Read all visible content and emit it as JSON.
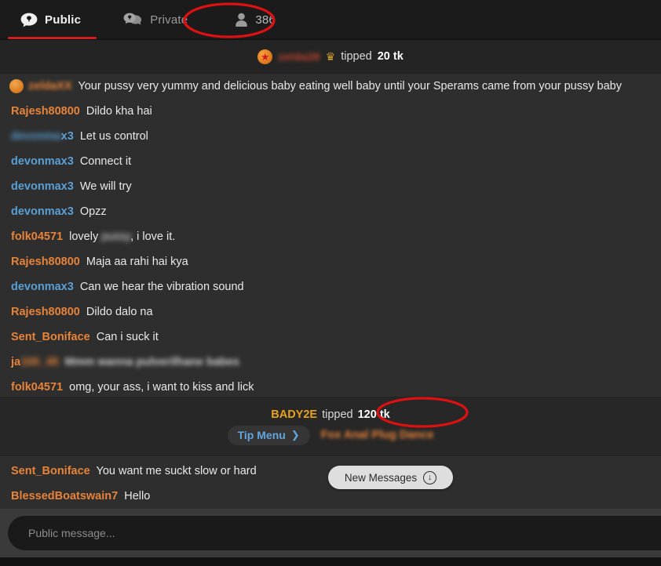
{
  "tabs": [
    {
      "id": "public",
      "label": "Public",
      "icon": "chat-bubble-icon",
      "active": true
    },
    {
      "id": "private",
      "label": "Private",
      "icon": "chat-bubbles-icon",
      "active": false
    },
    {
      "id": "users",
      "label": "386",
      "icon": "user-icon",
      "active": false
    }
  ],
  "top_tip": {
    "username": "zelda28",
    "username_redacted": true,
    "crown_icon": "crown-icon",
    "verb": "tipped",
    "amount": "20 tk"
  },
  "messages": [
    {
      "user": "",
      "user_redacted": true,
      "user_color": "orange",
      "avatar": true,
      "text": "Your pussy very yummy and delicious baby eating well baby until your Sperams came from your pussy baby"
    },
    {
      "user": "Rajesh80800",
      "user_color": "orange",
      "text": "Dildo kha hai"
    },
    {
      "user": "devonmax3",
      "user_color": "blue",
      "user_redacted": true,
      "text": "Let us control"
    },
    {
      "user": "devonmax3",
      "user_color": "blue",
      "text": "Connect it"
    },
    {
      "user": "devonmax3",
      "user_color": "blue",
      "text": "We will try"
    },
    {
      "user": "devonmax3",
      "user_color": "blue",
      "text": "Opzz"
    },
    {
      "user": "folk04571",
      "user_color": "orange",
      "text": "lovely pussy, i love it.",
      "blur_word": "pussy"
    },
    {
      "user": "Rajesh80800",
      "user_color": "orange",
      "text": "Maja aa rahi hai kya"
    },
    {
      "user": "devonmax3",
      "user_color": "blue",
      "text": "Can we hear the vibration sound"
    },
    {
      "user": "Rajesh80800",
      "user_color": "orange",
      "text": "Dildo dalo na"
    },
    {
      "user": "Sent_Boniface",
      "user_color": "orange",
      "text": "Can i suck it"
    },
    {
      "user": "ja100_45",
      "user_color": "orange",
      "user_redacted": true,
      "text_redacted": true,
      "text": "Mmm wanna pulverilhane babes"
    },
    {
      "user": "folk04571",
      "user_color": "orange",
      "text": "omg, your ass, i want to kiss and lick"
    }
  ],
  "tip_section": {
    "tipper": "BADY2E",
    "verb": "tipped",
    "amount": "120 tk",
    "tip_menu_label": "Tip Menu",
    "tip_menu_chevron": "chevron-right-icon",
    "menu_item": "Fox Anal Plug Dance",
    "menu_item_redacted": true
  },
  "bottom_messages": [
    {
      "user": "Sent_Boniface",
      "user_color": "orange",
      "text": "You want me suckt slow or hard"
    },
    {
      "user": "BlessedBoatswain7",
      "user_color": "orange",
      "text": "Hello"
    }
  ],
  "new_messages_button": {
    "label": "New Messages",
    "icon": "arrow-down-circle-icon"
  },
  "composer": {
    "placeholder": "Public message...",
    "value": ""
  },
  "annotations": [
    {
      "name": "user-count-highlight",
      "shape": "ellipse",
      "color": "#dd1111"
    },
    {
      "name": "tip-amount-highlight",
      "shape": "ellipse",
      "color": "#dd1111"
    }
  ],
  "colors": {
    "accent_red": "#d01e1e",
    "username_orange": "#e8833a",
    "username_blue": "#5a9fd4",
    "tipper_gold": "#e8a21f",
    "link_blue": "#62a6dd",
    "bg": "#2e2e2e",
    "header_bg": "#1b1b1b"
  }
}
